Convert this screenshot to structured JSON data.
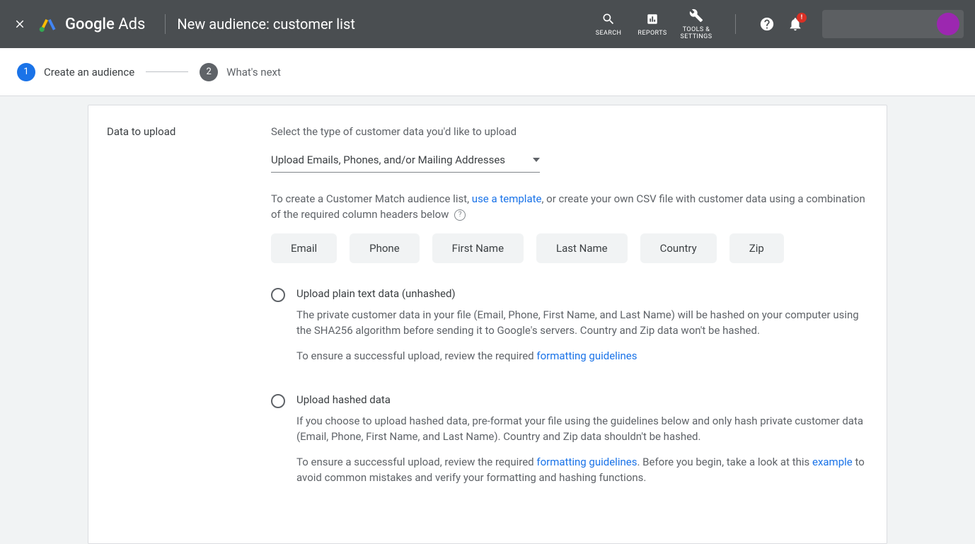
{
  "header": {
    "logo_bold": "Google",
    "logo_light": " Ads",
    "page_title": "New audience: customer list",
    "tools": {
      "search": "SEARCH",
      "reports": "REPORTS",
      "settings_line1": "TOOLS &",
      "settings_line2": "SETTINGS"
    },
    "notification_badge": "!"
  },
  "stepper": {
    "steps": [
      {
        "num": "1",
        "label": "Create an audience"
      },
      {
        "num": "2",
        "label": "What's next"
      }
    ]
  },
  "card": {
    "section_label": "Data to upload",
    "intro": "Select the type of customer data you'd like to upload",
    "dropdown_value": "Upload Emails, Phones, and/or Mailing Addresses",
    "desc_before": "To create a Customer Match audience list, ",
    "desc_link": "use a template",
    "desc_after": ", or create your own CSV file with customer data using a combination of the required column headers below ",
    "chips": [
      "Email",
      "Phone",
      "First Name",
      "Last Name",
      "Country",
      "Zip"
    ],
    "options": [
      {
        "title": "Upload plain text data (unhashed)",
        "desc": "The private customer data in your file (Email, Phone, First Name, and Last Name) will be hashed on your computer using the SHA256 algorithm before sending it to Google's servers. Country and Zip data won't be hashed.",
        "note_before": "To ensure a successful upload, review the required ",
        "note_link": "formatting guidelines",
        "note_after": ""
      },
      {
        "title": "Upload hashed data",
        "desc": "If you choose to upload hashed data, pre-format your file using the guidelines below and only hash private customer data (Email, Phone, First Name, and Last Name). Country and Zip data shouldn't be hashed.",
        "note_before": "To ensure a successful upload, review the required ",
        "note_link": "formatting guidelines",
        "note_mid": ". Before you begin, take a look at this ",
        "note_link2": "example",
        "note_after": " to avoid common mistakes and verify your formatting and hashing functions."
      }
    ]
  }
}
